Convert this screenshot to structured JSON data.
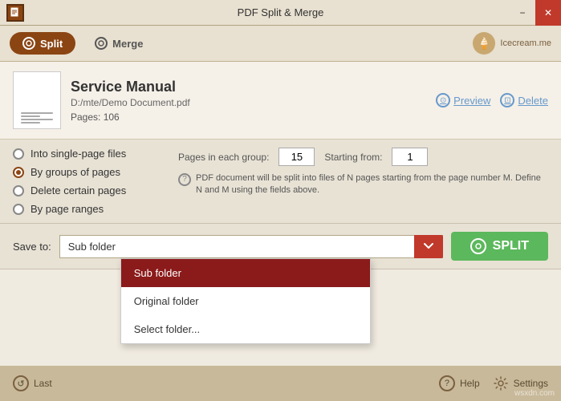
{
  "window": {
    "title": "PDF Split & Merge",
    "app_icon": "S",
    "min_btn": "−",
    "close_btn": "✕"
  },
  "toolbar": {
    "split_tab": "Split",
    "merge_tab": "Merge",
    "icecream_label": "Icecream.me"
  },
  "file": {
    "name": "Service Manual",
    "path": "D:/mte/Demo Document.pdf",
    "pages_label": "Pages: 106",
    "preview_label": "Preview",
    "delete_label": "Delete"
  },
  "options": {
    "radio1": "Into single-page files",
    "radio2": "By groups of pages",
    "radio3": "Delete certain pages",
    "radio4": "By page ranges",
    "pages_per_group_label": "Pages in each group:",
    "pages_per_group_value": "15",
    "starting_from_label": "Starting from:",
    "starting_from_value": "1",
    "description": "PDF document will be split into files of N pages starting from the page number M. Define N and M using the fields above."
  },
  "save": {
    "label": "Save to:",
    "value": "Sub folder",
    "split_btn": "SPLIT",
    "dropdown_items": [
      {
        "label": "Sub folder",
        "selected": true
      },
      {
        "label": "Original folder",
        "selected": false
      },
      {
        "label": "Select folder...",
        "selected": false
      }
    ]
  },
  "footer": {
    "last_label": "Last",
    "help_label": "Help",
    "settings_label": "Settings"
  },
  "watermark": "wsxdn.com"
}
